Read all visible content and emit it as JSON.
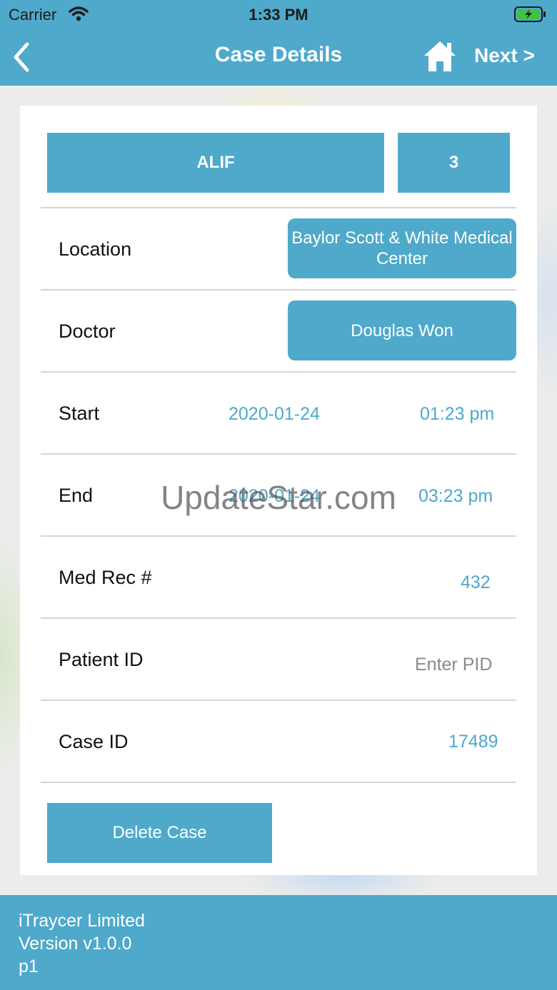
{
  "status_bar": {
    "carrier": "Carrier",
    "time": "1:33 PM"
  },
  "nav": {
    "title": "Case Details",
    "next_label": "Next >"
  },
  "case": {
    "procedure": "ALIF",
    "level": "3",
    "location_label": "Location",
    "location_value": "Baylor Scott & White Medical Center",
    "doctor_label": "Doctor",
    "doctor_value": "Douglas Won",
    "start_label": "Start",
    "start_date": "2020-01-24",
    "start_time": "01:23 pm",
    "end_label": "End",
    "end_date": "2020-01-24",
    "end_time": "03:23 pm",
    "medrec_label": "Med Rec #",
    "medrec_value": "432",
    "patient_label": "Patient ID",
    "patient_placeholder": "Enter PID",
    "caseid_label": "Case ID",
    "caseid_value": "17489",
    "delete_label": "Delete Case"
  },
  "watermark": "UpdateStar.com",
  "footer": {
    "line1": "iTraycer Limited",
    "line2": "Version v1.0.0",
    "line3": "p1"
  },
  "colors": {
    "accent": "#4ea9cb",
    "text": "#111111",
    "divider": "#d5d5d5",
    "placeholder": "#8a8a8a"
  }
}
